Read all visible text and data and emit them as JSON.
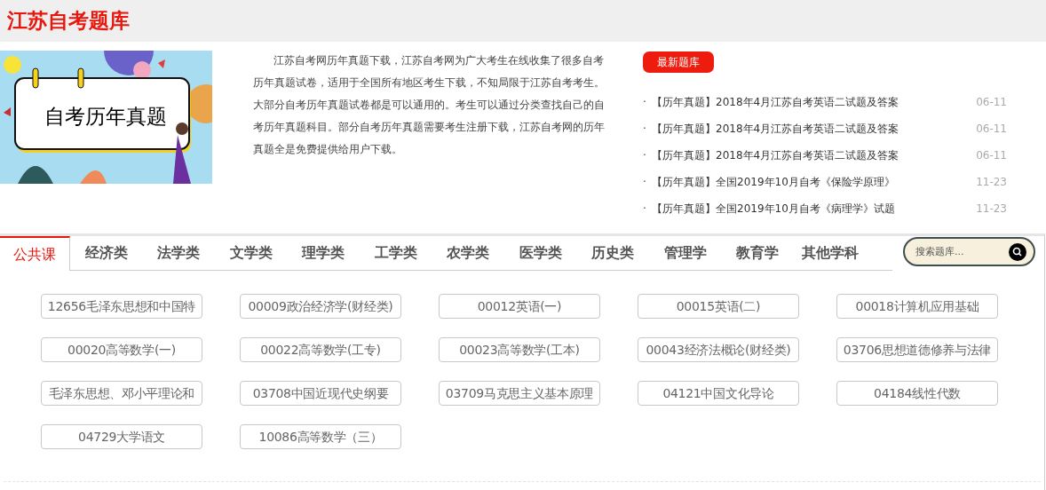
{
  "site_title": "江苏自考题库",
  "banner": {
    "caption": "自考历年真题"
  },
  "intro": "江苏自考网历年真题下载，江苏自考网为广大考生在线收集了很多自考历年真题试卷，适用于全国所有地区考生下载，不知局限于江苏自考考生。大部分自考历年真题试卷都是可以通用的。考生可以通过分类查找自己的自考历年真题科目。部分自考历年真题需要考生注册下载，江苏自考网的历年真题全是免费提供给用户下载。",
  "latest": {
    "badge": "最新题库",
    "items": [
      {
        "bullet": "·",
        "title": "【历年真题】2018年4月江苏自考英语二试题及答案",
        "date": "06-11"
      },
      {
        "bullet": "·",
        "title": "【历年真题】2018年4月江苏自考英语二试题及答案",
        "date": "06-11"
      },
      {
        "bullet": "·",
        "title": "【历年真题】2018年4月江苏自考英语二试题及答案",
        "date": "06-11"
      },
      {
        "bullet": "·",
        "title": "【历年真题】全国2019年10月自考《保险学原理》",
        "date": "11-23"
      },
      {
        "bullet": "·",
        "title": "【历年真题】全国2019年10月自考《病理学》试题",
        "date": "11-23"
      }
    ]
  },
  "tabs": [
    {
      "label": "公共课",
      "selected": true
    },
    {
      "label": "经济类",
      "selected": false
    },
    {
      "label": "法学类",
      "selected": false
    },
    {
      "label": "文学类",
      "selected": false
    },
    {
      "label": "理学类",
      "selected": false
    },
    {
      "label": "工学类",
      "selected": false
    },
    {
      "label": "农学类",
      "selected": false
    },
    {
      "label": "医学类",
      "selected": false
    },
    {
      "label": "历史类",
      "selected": false
    },
    {
      "label": "管理学",
      "selected": false
    },
    {
      "label": "教育学",
      "selected": false
    },
    {
      "label": "其他学科",
      "selected": false
    }
  ],
  "search": {
    "placeholder": "搜索题库..."
  },
  "courses": [
    "12656毛泽东思想和中国特",
    "00009政治经济学(财经类)",
    "00012英语(一)",
    "00015英语(二)",
    "00018计算机应用基础",
    "00020高等数学(一)",
    "00022高等数学(工专)",
    "00023高等数学(工本)",
    "00043经济法概论(财经类)",
    "03706思想道德修养与法律",
    "毛泽东思想、邓小平理论和",
    "03708中国近现代史纲要",
    "03709马克思主义基本原理",
    "04121中国文化导论",
    "04184线性代数",
    "04729大学语文",
    "10086高等数学（三）"
  ]
}
